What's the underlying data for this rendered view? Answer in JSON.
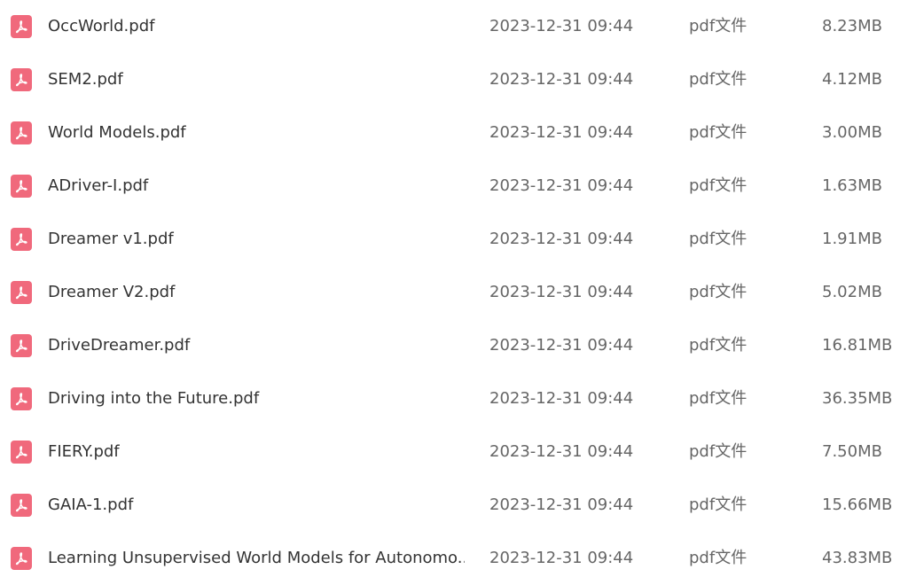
{
  "files": [
    {
      "name": "OccWorld.pdf",
      "date": "2023-12-31 09:44",
      "type": "pdf文件",
      "size": "8.23MB"
    },
    {
      "name": "SEM2.pdf",
      "date": "2023-12-31 09:44",
      "type": "pdf文件",
      "size": "4.12MB"
    },
    {
      "name": "World Models.pdf",
      "date": "2023-12-31 09:44",
      "type": "pdf文件",
      "size": "3.00MB"
    },
    {
      "name": "ADriver-I.pdf",
      "date": "2023-12-31 09:44",
      "type": "pdf文件",
      "size": "1.63MB"
    },
    {
      "name": "Dreamer v1.pdf",
      "date": "2023-12-31 09:44",
      "type": "pdf文件",
      "size": "1.91MB"
    },
    {
      "name": "Dreamer V2.pdf",
      "date": "2023-12-31 09:44",
      "type": "pdf文件",
      "size": "5.02MB"
    },
    {
      "name": "DriveDreamer.pdf",
      "date": "2023-12-31 09:44",
      "type": "pdf文件",
      "size": "16.81MB"
    },
    {
      "name": "Driving into the Future.pdf",
      "date": "2023-12-31 09:44",
      "type": "pdf文件",
      "size": "36.35MB"
    },
    {
      "name": "FIERY.pdf",
      "date": "2023-12-31 09:44",
      "type": "pdf文件",
      "size": "7.50MB"
    },
    {
      "name": "GAIA-1.pdf",
      "date": "2023-12-31 09:44",
      "type": "pdf文件",
      "size": "15.66MB"
    },
    {
      "name": "Learning Unsupervised World Models for Autonomo...",
      "date": "2023-12-31 09:44",
      "type": "pdf文件",
      "size": "43.83MB"
    }
  ],
  "icon": "pdf-file-icon",
  "colors": {
    "icon_bg": "#f0697c",
    "name_text": "#333333",
    "meta_text": "#666666"
  }
}
